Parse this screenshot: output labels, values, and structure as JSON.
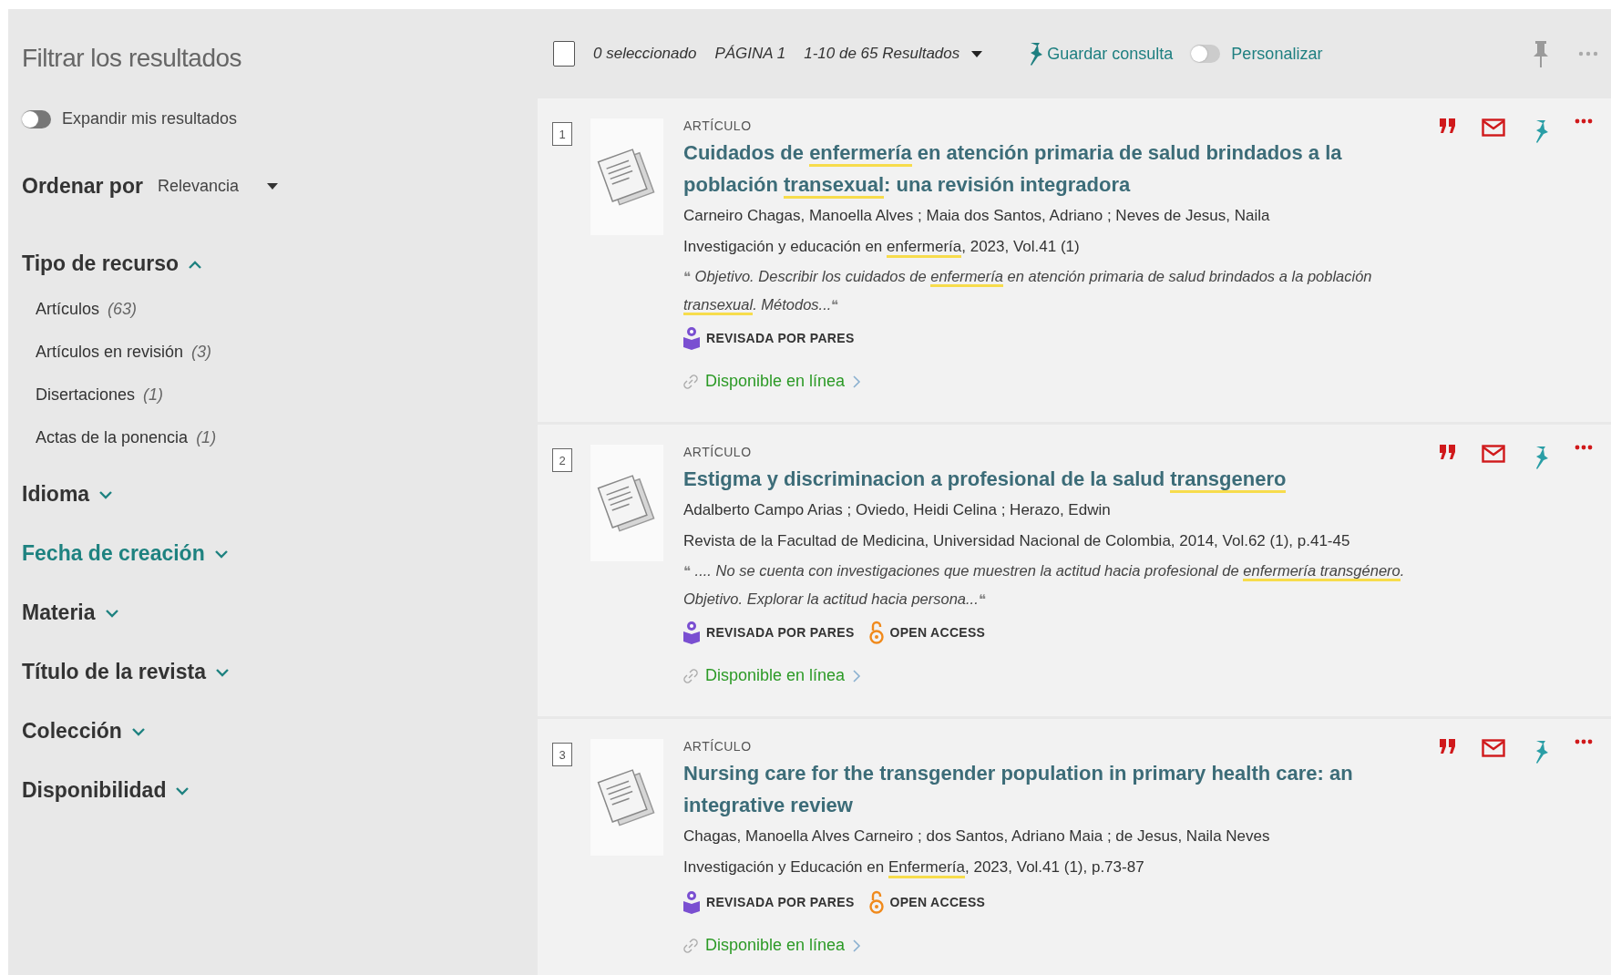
{
  "sidebar": {
    "title": "Filtrar los resultados",
    "expand_toggle": {
      "label": "Expandir mis resultados",
      "on": false
    },
    "sort": {
      "label": "Ordenar por",
      "value": "Relevancia"
    },
    "facets": [
      {
        "label": "Tipo de recurso",
        "expanded": true,
        "selected": false,
        "items": [
          {
            "label": "Artículos",
            "count": "(63)"
          },
          {
            "label": "Artículos en revisión",
            "count": "(3)"
          },
          {
            "label": "Disertaciones",
            "count": "(1)"
          },
          {
            "label": "Actas de la ponencia",
            "count": "(1)"
          }
        ]
      },
      {
        "label": "Idioma",
        "expanded": false,
        "selected": false
      },
      {
        "label": "Fecha de creación",
        "expanded": false,
        "selected": true
      },
      {
        "label": "Materia",
        "expanded": false,
        "selected": false
      },
      {
        "label": "Título de la revista",
        "expanded": false,
        "selected": false
      },
      {
        "label": "Colección",
        "expanded": false,
        "selected": false
      },
      {
        "label": "Disponibilidad",
        "expanded": false,
        "selected": false
      }
    ]
  },
  "toolbar": {
    "select_all": {
      "checked": false
    },
    "selected_count": "0 seleccionado",
    "page": "PÁGINA 1",
    "results_range": "1-10 de 65 Resultados",
    "save_query": "Guardar consulta",
    "personalize": {
      "label": "Personalizar",
      "on": false
    }
  },
  "results": [
    {
      "number": "1",
      "type": "ARTÍCULO",
      "title": [
        {
          "text": "Cuidados de ",
          "highlight": false
        },
        {
          "text": "enfermería",
          "highlight": true
        },
        {
          "text": " en atención primaria de salud brindados a la población ",
          "highlight": false
        },
        {
          "text": "transexual",
          "highlight": true
        },
        {
          "text": ": una revisión integradora",
          "highlight": false
        }
      ],
      "authors": "Carneiro Chagas, Manoella Alves ; Maia dos Santos, Adriano ; Neves de Jesus, Naila",
      "source": [
        {
          "text": "Investigación y educación en ",
          "highlight": false
        },
        {
          "text": "enfermería",
          "highlight": true
        },
        {
          "text": ", 2023, Vol.41 (1)",
          "highlight": false
        }
      ],
      "snippet": {
        "open_quote": "❝",
        "parts": [
          {
            "text": "Objetivo. Describir los cuidados de ",
            "highlight": false
          },
          {
            "text": "enfermería",
            "highlight": true
          },
          {
            "text": " en atención primaria de salud brindados a la población ",
            "highlight": false
          },
          {
            "text": "transexual",
            "highlight": true
          },
          {
            "text": ". Métodos...",
            "highlight": false
          }
        ],
        "close_quote": "❝"
      },
      "badges": [
        {
          "kind": "peer_reviewed",
          "label": "REVISADA POR PARES"
        }
      ],
      "availability": "Disponible en línea"
    },
    {
      "number": "2",
      "type": "ARTÍCULO",
      "title": [
        {
          "text": "Estigma y discriminacion a profesional de la salud ",
          "highlight": false
        },
        {
          "text": "transgenero",
          "highlight": true
        }
      ],
      "authors": "Adalberto Campo Arias ; Oviedo, Heidi Celina ; Herazo, Edwin",
      "source": [
        {
          "text": "Revista de la Facultad de Medicina, Universidad Nacional de Colombia, 2014, Vol.62 (1), p.41-45",
          "highlight": false
        }
      ],
      "snippet": {
        "open_quote": "❝",
        "parts": [
          {
            "text": ".... No se cuenta con investigaciones que muestren la actitud hacia profesional de ",
            "highlight": false
          },
          {
            "text": "enfermería transgénero",
            "highlight": true
          },
          {
            "text": ". Objetivo. Explorar la actitud hacia persona...",
            "highlight": false
          }
        ],
        "close_quote": "❝"
      },
      "badges": [
        {
          "kind": "peer_reviewed",
          "label": "REVISADA POR PARES"
        },
        {
          "kind": "open_access",
          "label": "OPEN ACCESS"
        }
      ],
      "availability": "Disponible en línea"
    },
    {
      "number": "3",
      "type": "ARTÍCULO",
      "title": [
        {
          "text": "Nursing care for the transgender population in primary health care: an integrative review",
          "highlight": false
        }
      ],
      "authors": "Chagas, Manoella Alves Carneiro ; dos Santos, Adriano Maia ; de Jesus, Naila Neves",
      "source": [
        {
          "text": "Investigación y Educación en ",
          "highlight": false
        },
        {
          "text": "Enfermería",
          "highlight": true
        },
        {
          "text": ", 2023, Vol.41 (1), p.73-87",
          "highlight": false
        }
      ],
      "badges": [
        {
          "kind": "peer_reviewed",
          "label": "REVISADA POR PARES"
        },
        {
          "kind": "open_access",
          "label": "OPEN ACCESS"
        }
      ],
      "availability": "Disponible en línea"
    }
  ]
}
